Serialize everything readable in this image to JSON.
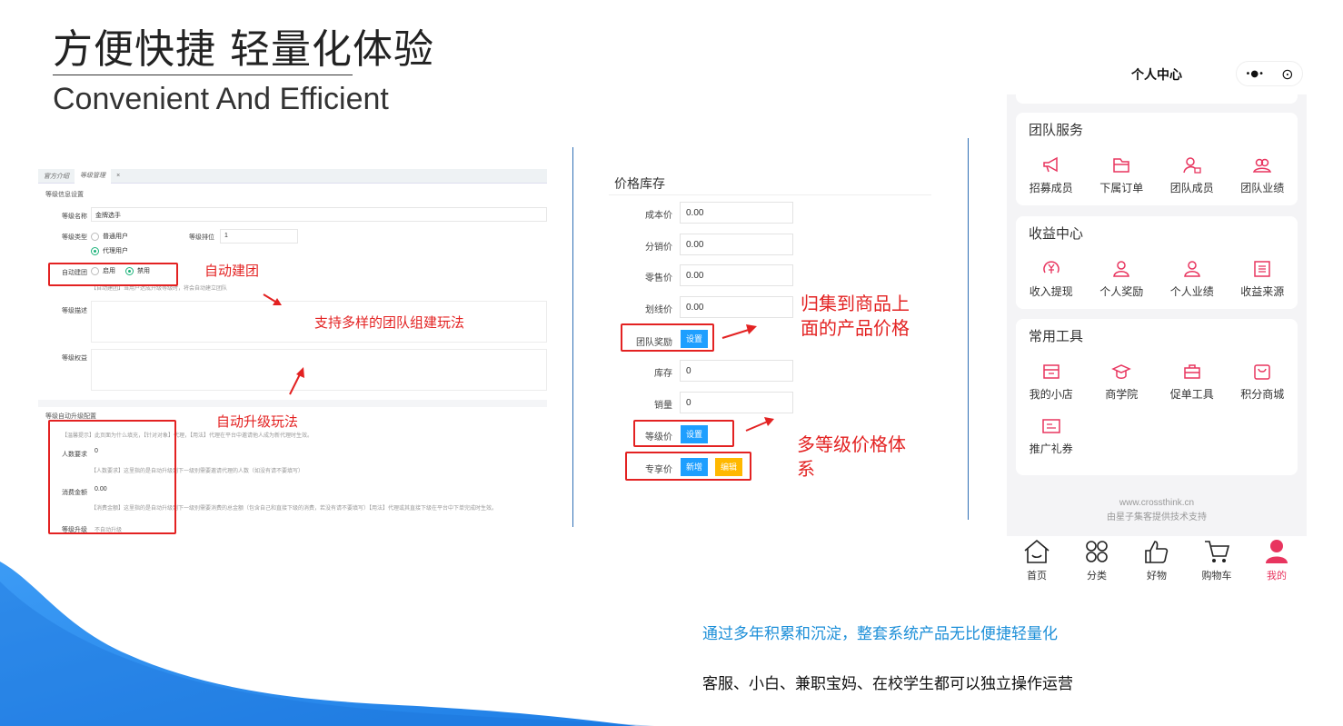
{
  "header": {
    "title": "方便快捷 轻量化体验",
    "subtitle": "Convenient And Efficient"
  },
  "admin_panel": {
    "tabs": [
      "官方介绍",
      "等级管理"
    ],
    "section_basic": "等级信息设置",
    "name_label": "等级名称",
    "name_value": "金牌选手",
    "type_label": "等级类型",
    "type_option_1": "普通用户",
    "type_option_2": "代理用户",
    "rank_label": "等级排位",
    "rank_value": "1",
    "auto_team_label": "自动建团",
    "auto_team_on": "启用",
    "auto_team_off": "禁用",
    "auto_team_hint": "【自动建团】当用户达成升级等级时，将会自动建立团队",
    "desc_label": "等级描述",
    "rights_label": "等级权益",
    "section_upgrade": "等级自动升级配置",
    "upgrade_hint": "【温馨提示】此页面为什么填充，【针对对象】代理，【用法】代理在平台中邀请他人成为新代理时生效。",
    "people_label": "人数要求",
    "people_value": "0",
    "people_hint": "【人数要求】这里指的是自动升级到下一级别需要邀请代理的人数（如没有请不要填写）",
    "amount_label": "消费金额",
    "amount_value": "0.00",
    "amount_hint": "【消费金额】这里指的是自动升级到下一级别需要消费的总金额（包含自己和直接下级的消费，若没有请不要填写）【用法】代理或其直接下级在平台中下单完成时生效。",
    "upgrade_label": "等级升级",
    "upgrade_value": "不自动升级"
  },
  "annotations": {
    "auto_team": "自动建团",
    "multi_team": "支持多样的团队组建玩法",
    "auto_upgrade": "自动升级玩法",
    "price_line1": "归集到商品上",
    "price_line2": "面的产品价格",
    "multi_level_line1": "多等级价格体",
    "multi_level_line2": "系"
  },
  "price_panel": {
    "title": "价格库存",
    "rows": [
      {
        "label": "成本价",
        "value": "0.00"
      },
      {
        "label": "分销价",
        "value": "0.00"
      },
      {
        "label": "零售价",
        "value": "0.00"
      },
      {
        "label": "划线价",
        "value": "0.00"
      }
    ],
    "team_reward_label": "团队奖励",
    "team_reward_button": "设置",
    "stock_label": "库存",
    "stock_value": "0",
    "sales_label": "销量",
    "sales_value": "0",
    "level_price_label": "等级价",
    "level_price_button": "设置",
    "exclusive_label": "专享价",
    "exclusive_add": "新增",
    "exclusive_edit": "编辑"
  },
  "phone": {
    "title": "个人中心",
    "capsule_more": "•●•",
    "capsule_close": "⊙",
    "sections": [
      {
        "title": "团队服务",
        "items": [
          {
            "label": "招募成员",
            "icon": "megaphone-icon"
          },
          {
            "label": "下属订单",
            "icon": "folder-icon"
          },
          {
            "label": "团队成员",
            "icon": "member-lock-icon"
          },
          {
            "label": "团队业绩",
            "icon": "group-icon"
          }
        ]
      },
      {
        "title": "收益中心",
        "items": [
          {
            "label": "收入提现",
            "icon": "yen-icon"
          },
          {
            "label": "个人奖励",
            "icon": "user-icon"
          },
          {
            "label": "个人业绩",
            "icon": "user-icon"
          },
          {
            "label": "收益来源",
            "icon": "list-icon"
          }
        ]
      },
      {
        "title": "常用工具",
        "items": [
          {
            "label": "我的小店",
            "icon": "shop-icon"
          },
          {
            "label": "商学院",
            "icon": "graduation-icon"
          },
          {
            "label": "促单工具",
            "icon": "briefcase-icon"
          },
          {
            "label": "积分商城",
            "icon": "bag-icon"
          },
          {
            "label": "推广礼券",
            "icon": "coupon-icon"
          }
        ]
      }
    ],
    "footer_url": "www.crossthink.cn",
    "footer_support": "由星子集客提供技术支持",
    "tabs": [
      {
        "label": "首页",
        "icon": "home-icon"
      },
      {
        "label": "分类",
        "icon": "category-icon"
      },
      {
        "label": "好物",
        "icon": "thumbs-up-icon"
      },
      {
        "label": "购物车",
        "icon": "cart-icon"
      },
      {
        "label": "我的",
        "icon": "profile-icon"
      }
    ]
  },
  "taglines": {
    "line1": "通过多年积累和沉淀，整套系统产品无比便捷轻量化",
    "line2": "客服、小白、兼职宝妈、在校学生都可以独立操作运营"
  },
  "colors": {
    "accent_red": "#e32222",
    "brand_pink": "#e8355f",
    "tag_blue": "#1d8fd8",
    "wave_blue": "#2a8ef0"
  }
}
